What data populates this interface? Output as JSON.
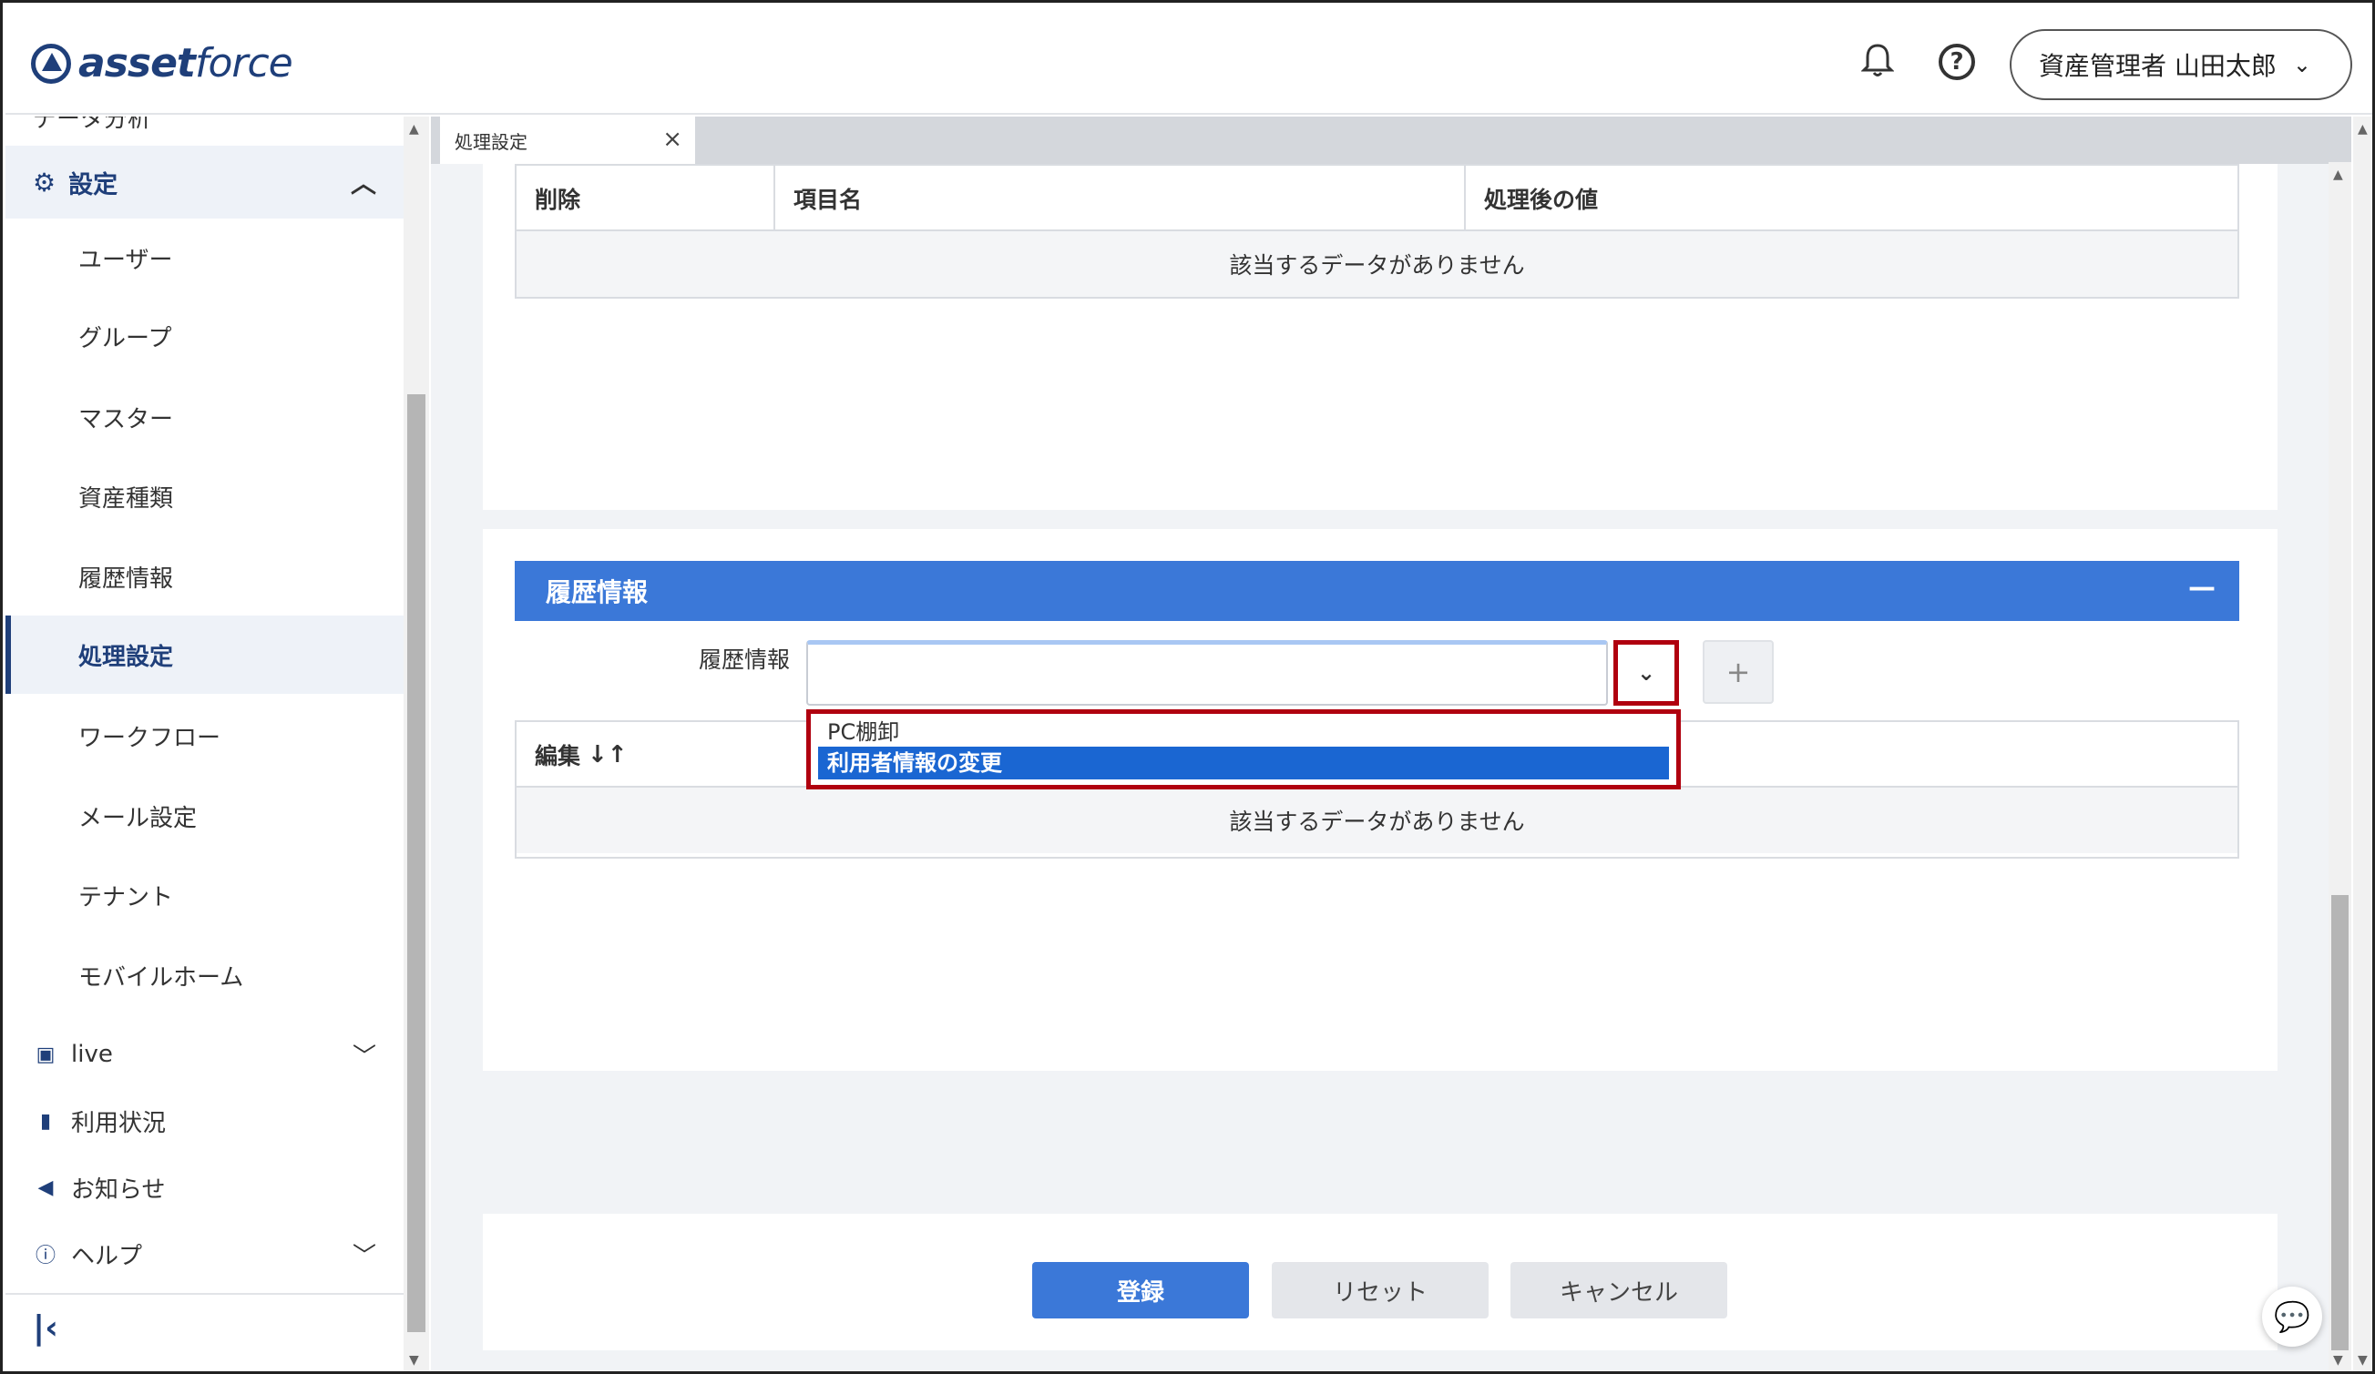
{
  "header": {
    "logo_bold": "asset",
    "logo_light": "force",
    "user_label": "資産管理者 山田太郎"
  },
  "sidebar": {
    "cut_item": "データ分析",
    "settings_label": "設定",
    "sub_items": [
      "ユーザー",
      "グループ",
      "マスター",
      "資産種類",
      "履歴情報",
      "処理設定",
      "ワークフロー",
      "メール設定",
      "テナント",
      "モバイルホーム"
    ],
    "active_sub": "処理設定",
    "main_items": [
      {
        "label": "live",
        "icon": "live-icon"
      },
      {
        "label": "利用状況",
        "icon": "bar-chart-icon"
      },
      {
        "label": "お知らせ",
        "icon": "megaphone-icon"
      },
      {
        "label": "ヘルプ",
        "icon": "help-circle-icon"
      }
    ]
  },
  "tab": {
    "label": "処理設定"
  },
  "table1": {
    "headers": [
      "削除",
      "項目名",
      "処理後の値"
    ],
    "empty_text": "該当するデータがありません"
  },
  "history_section": {
    "title": "履歴情報",
    "field_label": "履歴情報",
    "select_value": "",
    "add_label": "+",
    "options": [
      "PC棚卸",
      "利用者情報の変更"
    ],
    "selected_option": "利用者情報の変更"
  },
  "table2": {
    "headers": [
      "編集"
    ],
    "empty_text": "該当するデータがありません"
  },
  "actions": {
    "register": "登録",
    "reset": "リセット",
    "cancel": "キャンセル"
  },
  "colors": {
    "brand": "#1f3f7a",
    "accent": "#3b78d8",
    "highlight_border": "#b0000f",
    "selected_option": "#1a66d2"
  }
}
